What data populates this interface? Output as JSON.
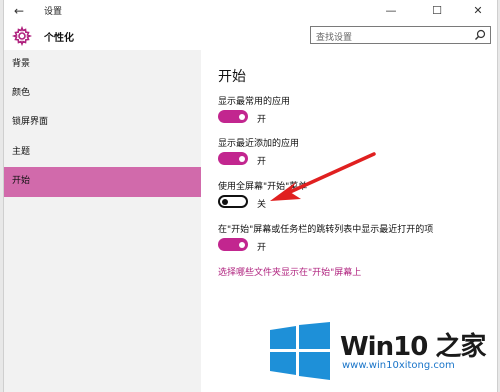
{
  "titlebar": {
    "back_icon": "back-arrow-icon",
    "title": "设置",
    "minimize": "—",
    "maximize": "☐",
    "close": "✕"
  },
  "header": {
    "icon": "gear-icon",
    "title": "个性化",
    "search_placeholder": "查找设置"
  },
  "sidebar": {
    "items": [
      {
        "label": "背景",
        "active": false
      },
      {
        "label": "颜色",
        "active": false
      },
      {
        "label": "锁屏界面",
        "active": false
      },
      {
        "label": "主题",
        "active": false
      },
      {
        "label": "开始",
        "active": true
      }
    ]
  },
  "main": {
    "heading": "开始",
    "settings": [
      {
        "label": "显示最常用的应用",
        "state": "开",
        "on": true
      },
      {
        "label": "显示最近添加的应用",
        "state": "开",
        "on": true
      },
      {
        "label": "使用全屏幕\"开始\"菜单",
        "state": "关",
        "on": false
      },
      {
        "label": "在\"开始\"屏幕或任务栏的跳转列表中显示最近打开的项",
        "state": "开",
        "on": true
      }
    ],
    "link": "选择哪些文件夹显示在\"开始\"屏幕上"
  },
  "watermark": {
    "text": "Win10 之家",
    "url": "www.win10xitong.com"
  },
  "colors": {
    "accent": "#c2268f",
    "sidebar_active": "#d16aab",
    "arrow": "#e02020",
    "logo_blue": "#1e90d8"
  }
}
